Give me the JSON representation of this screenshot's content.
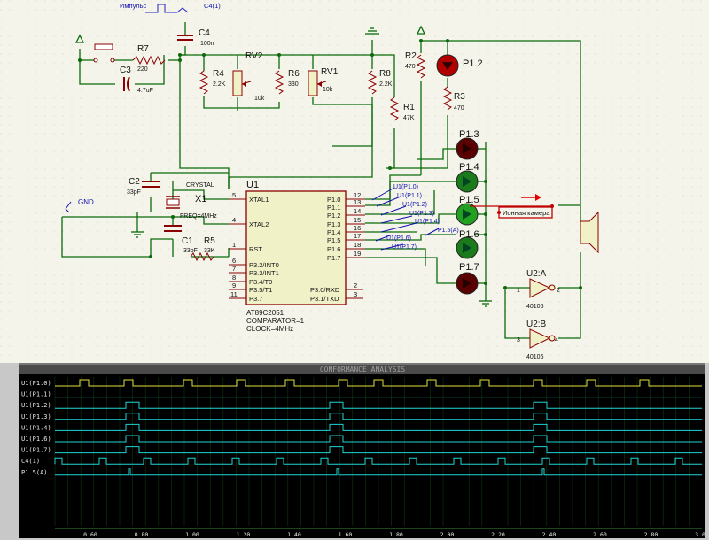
{
  "schematic": {
    "title_impulse": "Импульс",
    "c4_source": "C4(1)",
    "gnd": "GND",
    "r7": {
      "ref": "R7",
      "val": "220"
    },
    "c3": {
      "ref": "C3",
      "val": "4.7uF"
    },
    "c4": {
      "ref": "C4",
      "val": "100n"
    },
    "r4": {
      "ref": "R4",
      "val": "2.2K"
    },
    "rv2": {
      "ref": "RV2",
      "val": "10k"
    },
    "r6": {
      "ref": "R6",
      "val": "330"
    },
    "rv1": {
      "ref": "RV1",
      "val": "10k"
    },
    "r8": {
      "ref": "R8",
      "val": "2.2K"
    },
    "r2": {
      "ref": "R2",
      "val": "470"
    },
    "r1": {
      "ref": "R1",
      "val": "47K"
    },
    "r3": {
      "ref": "R3",
      "val": "470"
    },
    "r5": {
      "ref": "R5",
      "val": "33K"
    },
    "c2": {
      "ref": "C2",
      "val": "33pF"
    },
    "c1": {
      "ref": "C1",
      "val": "33pF"
    },
    "x1": {
      "ref": "X1",
      "type": "CRYSTAL",
      "freq": "FREQ=4MHz"
    },
    "u1": {
      "ref": "U1",
      "part": "AT89C2051",
      "prop1": "COMPARATOR=1",
      "prop2": "CLOCK=4MHz",
      "left_pins": [
        {
          "num": "5",
          "name": "XTAL1"
        },
        {
          "num": "4",
          "name": "XTAL2"
        },
        {
          "num": "1",
          "name": "RST"
        },
        {
          "num": "6",
          "name": "P3.2/INT0"
        },
        {
          "num": "7",
          "name": "P3.3/INT1"
        },
        {
          "num": "8",
          "name": "P3.4/T0"
        },
        {
          "num": "9",
          "name": "P3.5/T1"
        },
        {
          "num": "11",
          "name": "P3.7"
        }
      ],
      "right_pins": [
        {
          "num": "12",
          "name": "P1.0"
        },
        {
          "num": "13",
          "name": "P1.1"
        },
        {
          "num": "14",
          "name": "P1.2"
        },
        {
          "num": "15",
          "name": "P1.3"
        },
        {
          "num": "16",
          "name": "P1.4"
        },
        {
          "num": "17",
          "name": "P1.5"
        },
        {
          "num": "18",
          "name": "P1.6"
        },
        {
          "num": "19",
          "name": "P1.7"
        },
        {
          "num": "2",
          "name": "P3.0/RXD"
        },
        {
          "num": "3",
          "name": "P3.1/TXD"
        }
      ]
    },
    "probes": [
      "U1(P1.0)",
      "U1(P1.1)",
      "U1(P1.2)",
      "U1(P1.3)",
      "U1(P1.4)",
      "U1(P1.6)",
      "U1(P1.7)",
      "P1.5(A)"
    ],
    "leds": [
      "P1.2",
      "P1.3",
      "P1.4",
      "P1.5",
      "P1.6",
      "P1.7"
    ],
    "ion_label": "Ионная камера",
    "u2a": {
      "ref": "U2:A",
      "part": "40106",
      "pin_in": "1",
      "pin_out": "2"
    },
    "u2b": {
      "ref": "U2:B",
      "part": "40106",
      "pin_in": "3",
      "pin_out": "4"
    }
  },
  "analysis": {
    "title": "CONFORMANCE ANALYSIS",
    "channels": [
      "U1(P1.0)",
      "U1(P1.1)",
      "U1(P1.2)",
      "U1(P1.3)",
      "U1(P1.4)",
      "U1(P1.6)",
      "U1(P1.7)",
      "C4(1)",
      "P1.5(A)"
    ],
    "time_ticks": [
      "0.60",
      "0.80",
      "1.00",
      "1.20",
      "1.40",
      "1.60",
      "1.80",
      "2.00",
      "2.20",
      "2.40",
      "2.60",
      "2.80",
      "3.00"
    ],
    "colors": {
      "grid": "#103810",
      "trace": "#1fd5d5",
      "trace_yellow": "#e0e040",
      "label": "#e8e8e8"
    }
  }
}
